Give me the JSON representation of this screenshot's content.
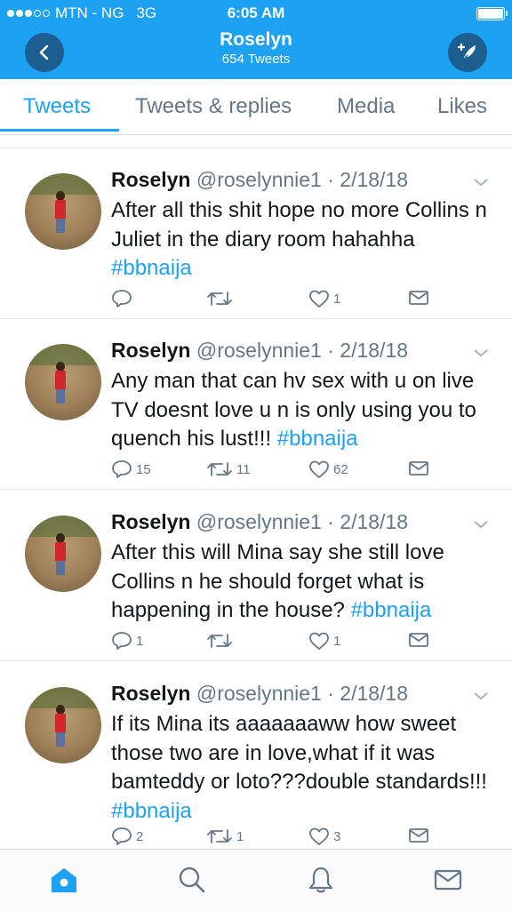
{
  "status_bar": {
    "carrier": "MTN - NG",
    "network": "3G",
    "time": "6:05 AM",
    "signal_bars": 3,
    "battery_level": 1.0
  },
  "nav": {
    "title": "Roselyn",
    "subtitle": "654 Tweets"
  },
  "tabs": [
    {
      "label": "Tweets",
      "active": true
    },
    {
      "label": "Tweets & replies",
      "active": false
    },
    {
      "label": "Media",
      "active": false
    },
    {
      "label": "Likes",
      "active": false
    }
  ],
  "tweets": [
    {
      "name": "Roselyn",
      "meta": "@roselynnie1 · 2/18/18",
      "text": "After all this shit hope no more Collins n Juliet in the diary room hahahha ",
      "hashtag": "#bbnaija",
      "replies": "",
      "retweets": "",
      "likes": "1"
    },
    {
      "name": "Roselyn",
      "meta": "@roselynnie1 · 2/18/18",
      "text": "Any man that can hv sex with u on live TV doesnt love u n is only using you to quench his lust!!! ",
      "hashtag": "#bbnaija",
      "replies": "15",
      "retweets": "11",
      "likes": "62"
    },
    {
      "name": "Roselyn",
      "meta": "@roselynnie1 · 2/18/18",
      "text": "After this will Mina say she still love Collins n he should forget what is happening in the house? ",
      "hashtag": "#bbnaija",
      "replies": "1",
      "retweets": "",
      "likes": "1"
    },
    {
      "name": "Roselyn",
      "meta": "@roselynnie1 · 2/18/18",
      "text": "If its Mina its aaaaaaaww how sweet those two are in love,what if it was bamteddy or loto???double standards!!! ",
      "hashtag": "#bbnaija",
      "replies": "2",
      "retweets": "1",
      "likes": "3"
    }
  ],
  "bottom_nav": [
    {
      "icon": "home-icon",
      "active": true
    },
    {
      "icon": "search-icon",
      "active": false
    },
    {
      "icon": "notifications-bell-icon",
      "active": false
    },
    {
      "icon": "messages-envelope-icon",
      "active": false
    }
  ],
  "colors": {
    "brand_blue": "#1da1f2",
    "nav_button_bg": "#1b5e8f",
    "secondary_text": "#657786"
  }
}
